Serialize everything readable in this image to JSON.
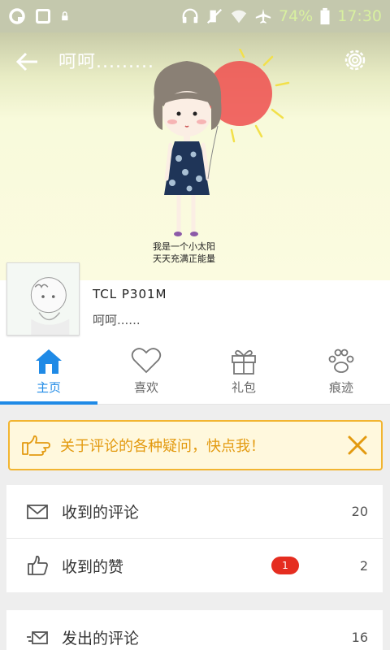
{
  "status_bar": {
    "battery_percent": "74%",
    "time": "17:30",
    "icons": [
      "q-app-icon",
      "square-app-icon",
      "lock-icon",
      "headphones-icon",
      "mute-icon",
      "wifi-icon",
      "airplane-icon",
      "battery-icon"
    ]
  },
  "header": {
    "title": "呵呵.........",
    "illustration_text_line1": "我是一个小太阳",
    "illustration_text_line2": "天天充满正能量"
  },
  "profile": {
    "device": "TCL P301M",
    "signature": "呵呵......"
  },
  "tabs": [
    {
      "label": "主页",
      "icon": "home-icon",
      "active": true
    },
    {
      "label": "喜欢",
      "icon": "heart-icon",
      "active": false
    },
    {
      "label": "礼包",
      "icon": "gift-icon",
      "active": false
    },
    {
      "label": "痕迹",
      "icon": "paw-icon",
      "active": false
    }
  ],
  "notice": {
    "text": "关于评论的各种疑问，快点我！"
  },
  "list_group1": [
    {
      "label": "收到的评论",
      "count": "20",
      "icon": "mail-icon"
    },
    {
      "label": "收到的赞",
      "count": "2",
      "badge": "1",
      "icon": "thumbs-up-icon"
    }
  ],
  "list_group2": [
    {
      "label": "发出的评论",
      "count": "16",
      "icon": "send-mail-icon"
    }
  ],
  "colors": {
    "accent": "#1f8ae6",
    "notice_border": "#f2b531",
    "notice_text": "#e39a10",
    "badge": "#e52d20"
  }
}
